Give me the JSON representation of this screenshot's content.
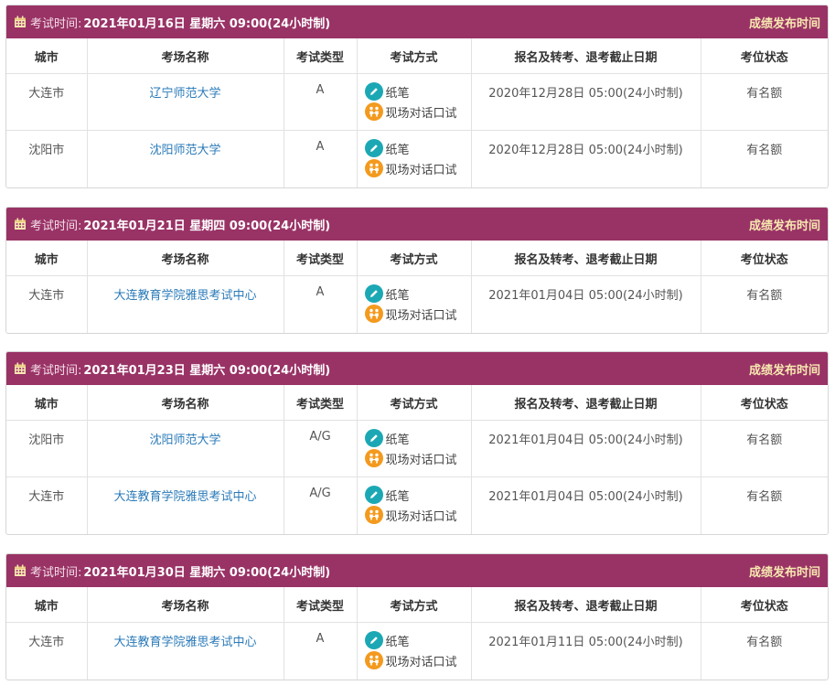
{
  "columns": [
    "城市",
    "考场名称",
    "考试类型",
    "考试方式",
    "报名及转考、退考截止日期",
    "考位状态"
  ],
  "header_label": "考试时间:",
  "result_link": "成绩发布时间",
  "modes": [
    "纸笔",
    "现场对话口试"
  ],
  "icons": {
    "calendar": "calendar-icon",
    "paper": "pencil-icon",
    "speaking": "speaking-icon"
  },
  "colors": {
    "header_bg": "#993366",
    "link": "#2a7ab8",
    "paper_icon": "#1ba8b4",
    "speaking_icon": "#f39a1e"
  },
  "sessions": [
    {
      "date": "2021年01月16日 星期六 09:00(24小时制)",
      "rows": [
        {
          "city": "大连市",
          "venue": "辽宁师范大学",
          "type": "A",
          "deadline": "2020年12月28日 05:00(24小时制)",
          "status": "有名额"
        },
        {
          "city": "沈阳市",
          "venue": "沈阳师范大学",
          "type": "A",
          "deadline": "2020年12月28日 05:00(24小时制)",
          "status": "有名额"
        }
      ]
    },
    {
      "date": "2021年01月21日 星期四 09:00(24小时制)",
      "rows": [
        {
          "city": "大连市",
          "venue": "大连教育学院雅思考试中心",
          "type": "A",
          "deadline": "2021年01月04日 05:00(24小时制)",
          "status": "有名额"
        }
      ]
    },
    {
      "date": "2021年01月23日 星期六 09:00(24小时制)",
      "rows": [
        {
          "city": "沈阳市",
          "venue": "沈阳师范大学",
          "type": "A/G",
          "deadline": "2021年01月04日 05:00(24小时制)",
          "status": "有名额"
        },
        {
          "city": "大连市",
          "venue": "大连教育学院雅思考试中心",
          "type": "A/G",
          "deadline": "2021年01月04日 05:00(24小时制)",
          "status": "有名额"
        }
      ]
    },
    {
      "date": "2021年01月30日 星期六 09:00(24小时制)",
      "rows": [
        {
          "city": "大连市",
          "venue": "大连教育学院雅思考试中心",
          "type": "A",
          "deadline": "2021年01月11日 05:00(24小时制)",
          "status": "有名额"
        }
      ]
    }
  ]
}
